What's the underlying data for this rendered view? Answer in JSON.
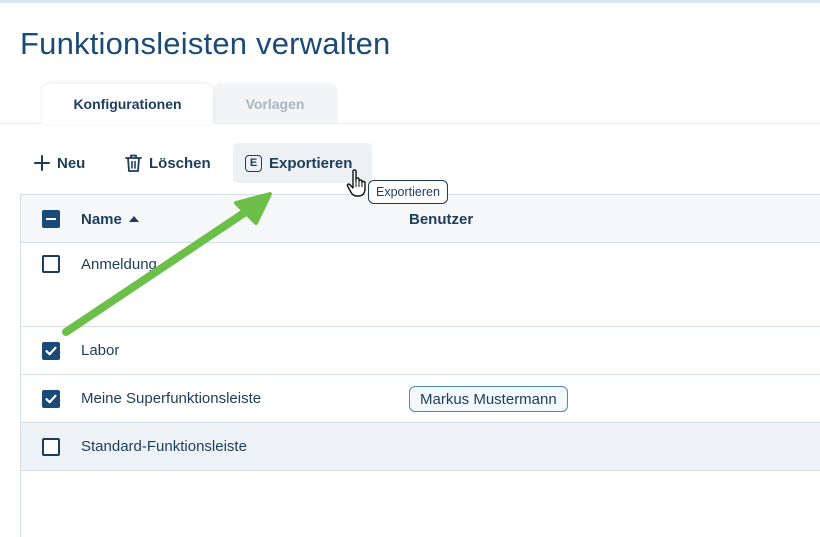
{
  "page": {
    "title": "Funktionsleisten verwalten"
  },
  "tabs": [
    {
      "label": "Konfigurationen",
      "active": true
    },
    {
      "label": "Vorlagen",
      "active": false
    }
  ],
  "toolbar": {
    "new_label": "Neu",
    "delete_label": "Löschen",
    "export_label": "Exportieren",
    "export_icon_letter": "E"
  },
  "tooltip": {
    "text": "Exportieren"
  },
  "table": {
    "select_all_state": "indeterminate",
    "columns": [
      {
        "label": "Name",
        "sort": "ascending"
      },
      {
        "label": "Benutzer"
      }
    ],
    "rows": [
      {
        "name": "Anmeldung",
        "checked": false,
        "user": ""
      },
      {
        "name": "Labor",
        "checked": true,
        "user": ""
      },
      {
        "name": "Meine Superfunktionsleiste",
        "checked": true,
        "user": "Markus Mustermann"
      },
      {
        "name": "Standard-Funktionsleiste",
        "checked": false,
        "user": "",
        "highlighted": true
      }
    ]
  },
  "colors": {
    "brand": "#1b4a78",
    "text": "#1d3d5c",
    "annotation_arrow": "#6cc04a"
  },
  "icons": {
    "new": "plus-icon",
    "delete": "trash-icon",
    "export": "export-e-icon",
    "sort": "sort-ascending-icon",
    "cursor": "hand-cursor-icon"
  }
}
